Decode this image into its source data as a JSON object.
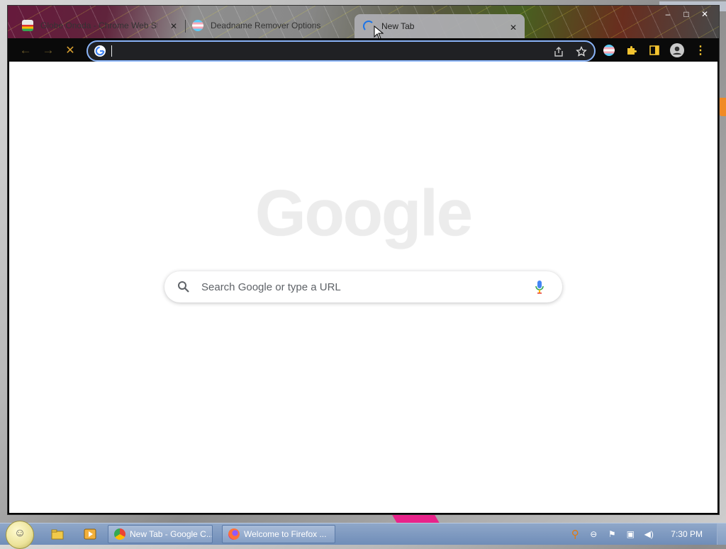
{
  "browser": {
    "tabs": [
      {
        "title": "Globe Onoda - Chrome Web St",
        "active": false
      },
      {
        "title": "Deadname Remover Options",
        "active": false
      },
      {
        "title": "New Tab",
        "active": true
      }
    ],
    "close_glyph": "✕",
    "window_controls": {
      "minimize": "–",
      "maximize": "□",
      "close": "✕"
    },
    "nav": {
      "back": "←",
      "forward": "→",
      "stop": "✕"
    },
    "omnibox": {
      "value": "",
      "placeholder": ""
    },
    "colors": {
      "toolbar": "#0a0a0a",
      "omnibox_focus": "#8ab4f8",
      "extension_puzzle": "#f4c430"
    }
  },
  "new_tab_page": {
    "logo_text": "Google",
    "search_placeholder": "Search Google or type a URL"
  },
  "taskbar": {
    "buttons": [
      {
        "label": "New Tab - Google C...",
        "icon": "chrome-icon"
      },
      {
        "label": "Welcome to Firefox ...",
        "icon": "firefox-icon"
      }
    ],
    "clock": "7:30 PM"
  }
}
